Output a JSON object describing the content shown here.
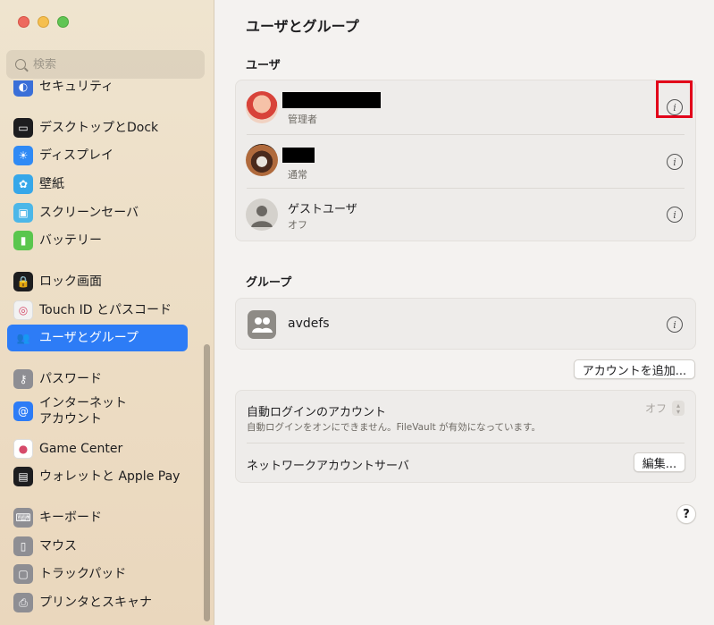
{
  "window": {
    "title": "ユーザとグループ"
  },
  "sidebar": {
    "search_placeholder": "検索",
    "items": [
      {
        "label": "セキュリティ",
        "icon": "security-icon",
        "color": "#3a6fd8"
      },
      {
        "label": "デスクトップとDock",
        "icon": "dock-icon",
        "color": "#1d1d1f"
      },
      {
        "label": "ディスプレイ",
        "icon": "display-icon",
        "color": "#2f8af5"
      },
      {
        "label": "壁紙",
        "icon": "wallpaper-icon",
        "color": "#36a7e9"
      },
      {
        "label": "スクリーンセーバ",
        "icon": "screensaver-icon",
        "color": "#4cb7e8"
      },
      {
        "label": "バッテリー",
        "icon": "battery-icon",
        "color": "#5ac64d"
      },
      {
        "label": "ロック画面",
        "icon": "lock-icon",
        "color": "#1d1d1f"
      },
      {
        "label": "Touch ID とパスコード",
        "icon": "fingerprint-icon",
        "color": "#f2f2f2"
      },
      {
        "label": "ユーザとグループ",
        "icon": "users-icon",
        "color": "#2d7cf6"
      },
      {
        "label": "パスワード",
        "icon": "key-icon",
        "color": "#8e8e93"
      },
      {
        "label": "インターネット\nアカウント",
        "icon": "at-icon",
        "color": "#2d7cf6"
      },
      {
        "label": "Game Center",
        "icon": "game-center-icon",
        "color": "#ffffff"
      },
      {
        "label": "ウォレットと Apple Pay",
        "icon": "wallet-icon",
        "color": "#1d1d1f"
      },
      {
        "label": "キーボード",
        "icon": "keyboard-icon",
        "color": "#8e8e93"
      },
      {
        "label": "マウス",
        "icon": "mouse-icon",
        "color": "#8e8e93"
      },
      {
        "label": "トラックパッド",
        "icon": "trackpad-icon",
        "color": "#8e8e93"
      },
      {
        "label": "プリンタとスキャナ",
        "icon": "printer-icon",
        "color": "#8e8e93"
      }
    ],
    "selected_index": 8
  },
  "main": {
    "users_heading": "ユーザ",
    "users": [
      {
        "name": "",
        "role": "管理者",
        "name_redacted": true
      },
      {
        "name": "",
        "role": "通常",
        "name_redacted": true
      },
      {
        "name": "ゲストユーザ",
        "role": "オフ",
        "name_redacted": false
      }
    ],
    "groups_heading": "グループ",
    "groups": [
      {
        "name": "avdefs"
      }
    ],
    "add_account_label": "アカウントを追加...",
    "auto_login": {
      "title": "自動ログインのアカウント",
      "note": "自動ログインをオンにできません。FileVault が有効になっています。",
      "value": "オフ"
    },
    "network_server": {
      "title": "ネットワークアカウントサーバ",
      "edit_label": "編集..."
    },
    "help_label": "?"
  },
  "colors": {
    "accent": "#2d7cf6",
    "highlight": "#e2001a"
  }
}
